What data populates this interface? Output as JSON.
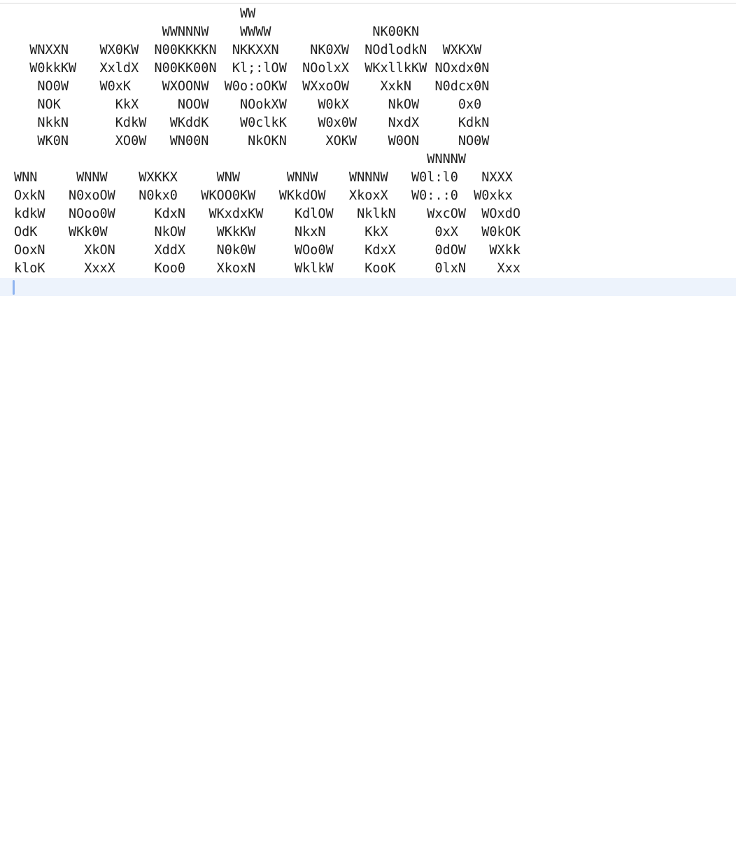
{
  "document": {
    "lines": [
      "                             WW",
      "                   WWNNNW    WWWW             NK00KN",
      "  WNXXN    WX0KW  N00KKKKN  NKKXXN    NK0XW  NOdlodkN  WXKXW",
      "  W0kkKW   XxldX  N00KK00N  Kl;:lOW  NOolxX  WKxllkKW NOxdx0N",
      "   NO0W    W0xK    WXOONW  W0o:oOKW  WXxoOW    XxkN   N0dcx0N",
      "   NOK       KkX     NOOW    NOokXW    W0kX     NkOW     0x0",
      "   NkkN      KdkW   WKddK    W0clkK    W0x0W    NxdX     KdkN",
      "   WK0N      XO0W   WN00N     NkOKN     XOKW    W0ON     NO0W",
      "                                                     WNNNW",
      "WNN     WNNW    WXKKX     WNW      WNNW    WNNNW   W0l:l0   NXXX",
      "OxkN   N0xoOW   N0kx0   WKOO0KW   WKkdOW   XkoxX   W0:.:0  W0xkx",
      "kdkW   NOoo0W     KdxN   WKxdxKW    KdlOW   NklkN    WxcOW  WOxdO",
      "OdK    WKk0W      NkOW    WKkKW     NkxN     KkX      0xX   W0kOK",
      "OoxN     XkON     XddX    N0k0W     WOo0W    KdxX     0dOW   WXkk",
      "kloK     XxxX     Koo0    XkoxN     WklkW    KooK     0lxN    Xxx",
      ""
    ]
  }
}
